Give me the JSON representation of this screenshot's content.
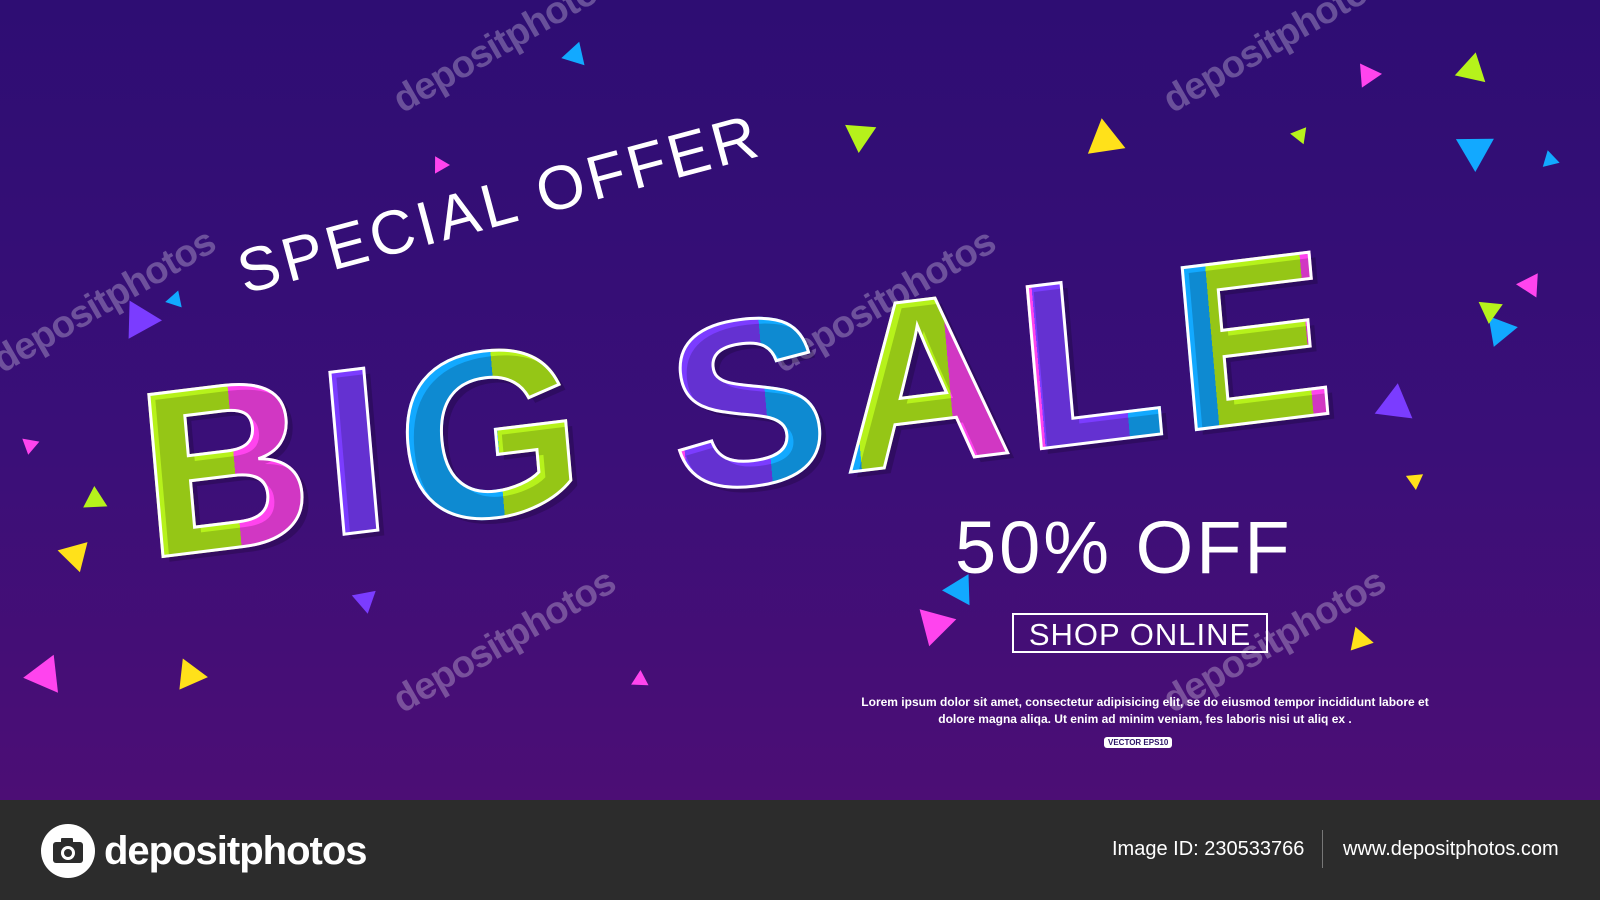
{
  "banner": {
    "special_offer": "SPECIAL OFFER",
    "headline": "BIG SALE",
    "discount": "50% OFF",
    "cta": "SHOP ONLINE",
    "body_text_line1": "Lorem ipsum dolor sit amet, consectetur adipisicing elit, se  do eiusmod tempor incididunt  labore et",
    "body_text_line2": "dolore magna aliqa.   Ut enim ad minim veniam, fes  laboris nisi ut aliq ex .",
    "vector_badge": "VECTOR EPS10",
    "watermark": "depositphotos",
    "colors": {
      "background_top": "#2e0d73",
      "background_bottom": "#4c0e75",
      "lime": "#b6f21b",
      "magenta": "#ff44ee",
      "violet": "#7b3cff",
      "blue": "#12a9ff",
      "yellow": "#ffe11a"
    }
  },
  "footer": {
    "brand": "depositphotos",
    "logo_icon": "camera-icon",
    "image_id": "Image ID: 230533766",
    "site_url": "www.depositphotos.com"
  }
}
